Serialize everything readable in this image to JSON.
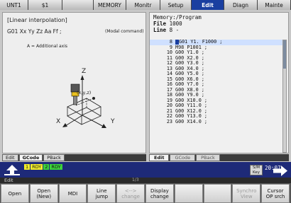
{
  "topbar": {
    "tabs": [
      {
        "label": "UNT1"
      },
      {
        "label": "$1"
      },
      {
        "label": ""
      },
      {
        "label": "MEMORY"
      },
      {
        "label": "Monitr"
      },
      {
        "label": "Setup"
      },
      {
        "label": "Edit",
        "active": true
      },
      {
        "label": "Diagn"
      },
      {
        "label": "Mainte"
      }
    ]
  },
  "guide": {
    "title": "[Linear interpolation]",
    "format": "G01 Xx Yy Zz Aa Ff ;",
    "modal": "(Modal command)",
    "note": "A = Additional axis",
    "axis_z": "Z",
    "axis_x": "X",
    "axis_y": "Y",
    "coord": "(x,y,z)"
  },
  "left_tabs": [
    "Edit",
    "GCode",
    "PBack"
  ],
  "program": {
    "header1": "Memory:/Program",
    "file_label": "File",
    "file_value": "1000",
    "line_label": "Line",
    "line_value": "8 -",
    "lines": [
      {
        "n": "8",
        "code": "G01 Y1. F1000 ;",
        "current": true
      },
      {
        "n": "9",
        "code": "M98 P1001 ;"
      },
      {
        "n": "10",
        "code": "G00 Y1.0 ;"
      },
      {
        "n": "11",
        "code": "G00 X2.0 ;"
      },
      {
        "n": "12",
        "code": "G00 Y3.0 ;"
      },
      {
        "n": "13",
        "code": "G00 X4.0 ;"
      },
      {
        "n": "14",
        "code": "G00 Y5.0 ;"
      },
      {
        "n": "15",
        "code": "G00 X6.0 ;"
      },
      {
        "n": "16",
        "code": "G00 Y7.0 ;"
      },
      {
        "n": "17",
        "code": "G00 X8.0 ;"
      },
      {
        "n": "18",
        "code": "G00 Y9.0 ;"
      },
      {
        "n": "19",
        "code": "G00 X10.0 ;"
      },
      {
        "n": "20",
        "code": "G00 Y11.0 ;"
      },
      {
        "n": "21",
        "code": "G00 X12.0 ;"
      },
      {
        "n": "22",
        "code": "G00 Y13.0 ;"
      },
      {
        "n": "23",
        "code": "G00 X14.0 ;"
      }
    ]
  },
  "right_tabs": [
    "Edit",
    "GCode",
    "PBack"
  ],
  "status": {
    "rdy": [
      "1",
      "RDY",
      "2",
      "RDY"
    ],
    "sm_key": "S/M\nKey",
    "clock": "20:07"
  },
  "edit_strip": {
    "label": "Edit",
    "page": "1/3"
  },
  "softkeys": [
    {
      "label": "Open"
    },
    {
      "label": "Open\n(New)"
    },
    {
      "label": "MDI"
    },
    {
      "label": "Line\njump"
    },
    {
      "label": "<-->\nchange",
      "dim": true
    },
    {
      "label": "Display\nchange"
    },
    {
      "label": ""
    },
    {
      "label": ""
    },
    {
      "label": "Synchro\nView",
      "dim": true
    },
    {
      "label": "Cursor\nOP srch"
    }
  ],
  "colors": {
    "active_tab": "#1a3fa0",
    "status_bar": "#1e2a78",
    "rdy_yellow": "#f2ee2a",
    "rdy_green": "#3cd23c"
  }
}
